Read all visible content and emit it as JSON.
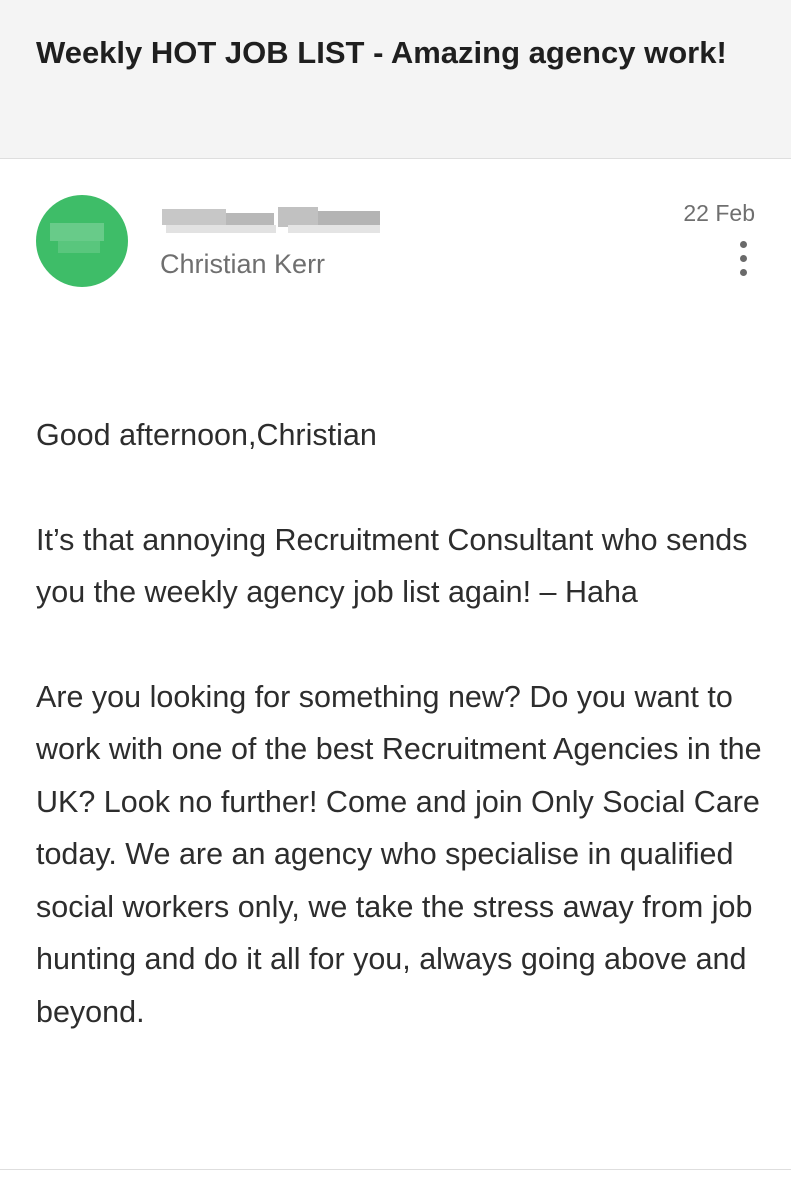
{
  "email": {
    "subject": "Weekly HOT JOB LIST - Amazing agency work!",
    "recipient": "Christian Kerr",
    "date": "22 Feb",
    "avatar_color": "#3ebd68",
    "more_icon": "more-vert-icon",
    "greeting": "Good afternoon,Christian",
    "paragraphs": [
      "It’s that annoying Recruitment Consultant who sends you the weekly agency job list again! – Haha",
      "Are you looking for something new? Do you want to work with one of the best Recruitment Agencies in the UK? Look no further! Come and join Only Social Care today. We are an agency who specialise in qualified social workers only, we take the stress away from job hunting and do it all for you, always going above and beyond."
    ]
  }
}
